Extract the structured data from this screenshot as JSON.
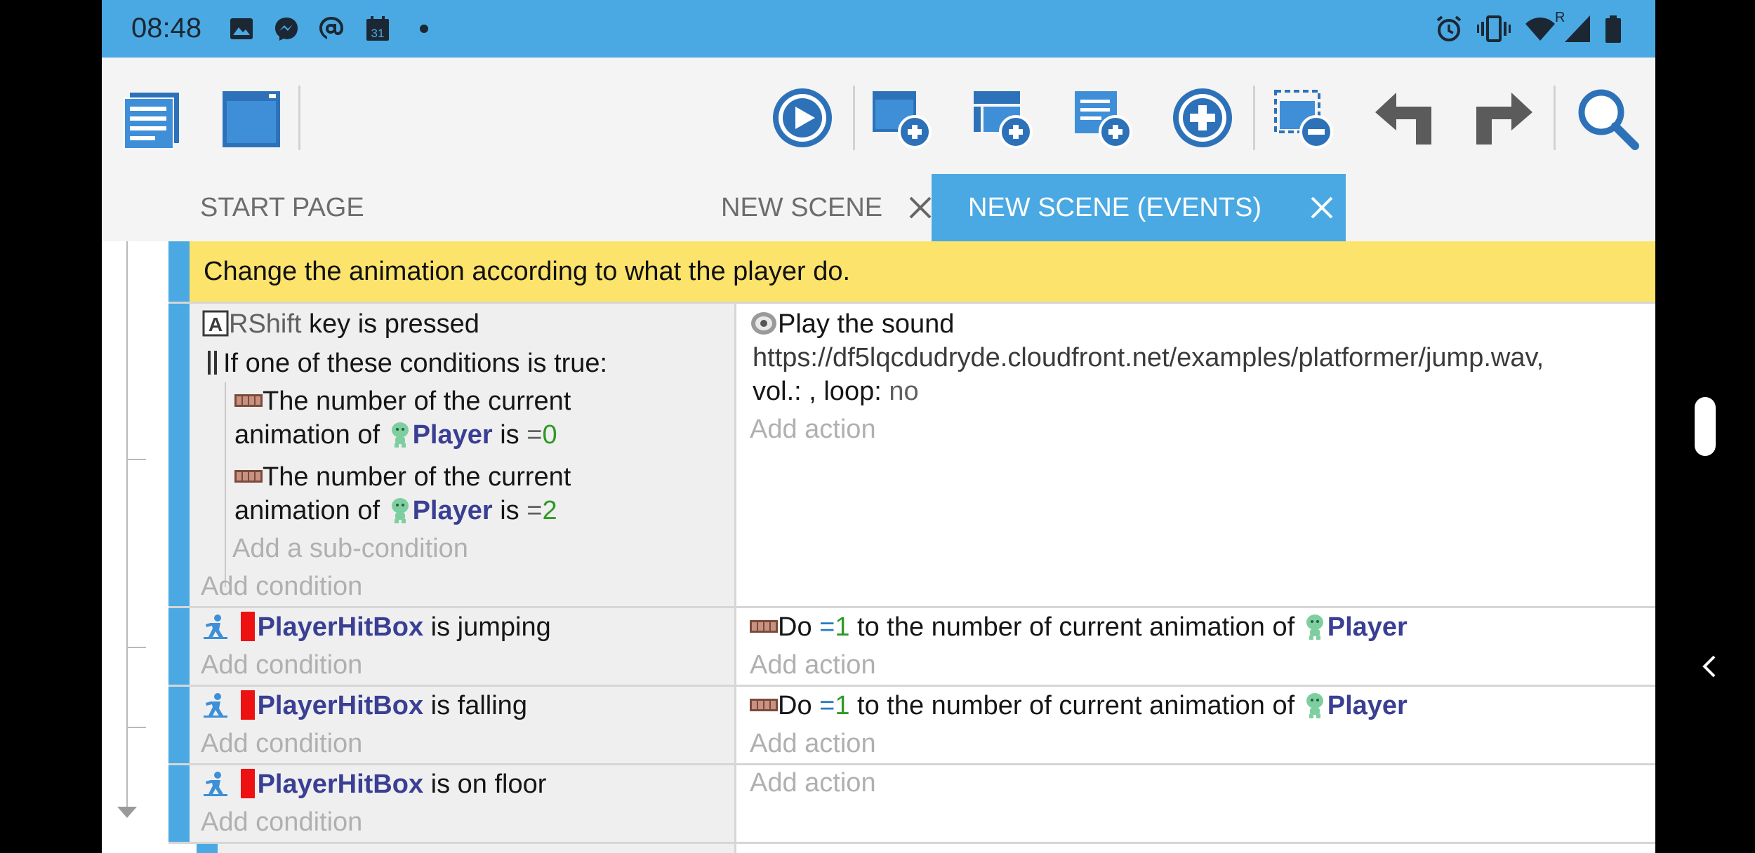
{
  "status_bar": {
    "time": "08:48",
    "calendar_day": "31",
    "left_icons": [
      "image-icon",
      "messenger-icon",
      "at-sign-icon",
      "calendar-icon",
      "dot-icon"
    ],
    "right_icons": [
      "alarm-icon",
      "vibrate-icon",
      "wifi-icon",
      "signal-icon",
      "battery-icon"
    ],
    "signal_label": "R"
  },
  "toolbar": {
    "buttons": [
      "project-manager",
      "scene-editor",
      "preview",
      "add-event",
      "add-sub-event",
      "add-other-event",
      "add-condition-action",
      "delete",
      "undo",
      "redo",
      "search"
    ]
  },
  "tabs": {
    "start_page": "START PAGE",
    "new_scene": "NEW SCENE",
    "new_scene_events": "NEW SCENE (EVENTS)"
  },
  "sheet": {
    "comment": "Change the animation according to what the player do.",
    "add_condition": "Add condition",
    "add_action": "Add action",
    "add_sub_condition": "Add a sub-condition",
    "event1": {
      "cond_key": "RShift",
      "cond_key_rest": " key is pressed",
      "or_label": "If one of these conditions is true:",
      "sub1_line1": "The number of the current",
      "sub1_line2_pre": "animation of ",
      "sub1_obj": "Player",
      "sub1_is": " is ",
      "sub1_op": "=",
      "sub1_val": "0",
      "sub2_line1": "The number of the current",
      "sub2_line2_pre": "animation of ",
      "sub2_obj": "Player",
      "sub2_is": " is ",
      "sub2_op": "=",
      "sub2_val": "2",
      "action_title": "Play the sound",
      "action_url": "https://df5lqcdudryde.cloudfront.net/examples/platformer/jump.wav,",
      "action_vol": "vol.: , loop: ",
      "action_loop": "no"
    },
    "event2": {
      "obj": "PlayerHitBox",
      "cond_rest": " is jumping",
      "act_pre": "Do ",
      "act_op": "=",
      "act_val": "1",
      "act_mid": " to the number of current animation of ",
      "act_obj": "Player"
    },
    "event3": {
      "obj": "PlayerHitBox",
      "cond_rest": " is falling",
      "act_pre": "Do ",
      "act_op": "=",
      "act_val": "1",
      "act_mid": " to the number of current animation of ",
      "act_obj": "Player"
    },
    "event4": {
      "obj": "PlayerHitBox",
      "cond_rest": " is on floor"
    }
  },
  "colors": {
    "accent": "#4aa9e2",
    "comment_bg": "#fbe36c",
    "object_text": "#3a3f94",
    "number_text": "#2e9a26"
  }
}
